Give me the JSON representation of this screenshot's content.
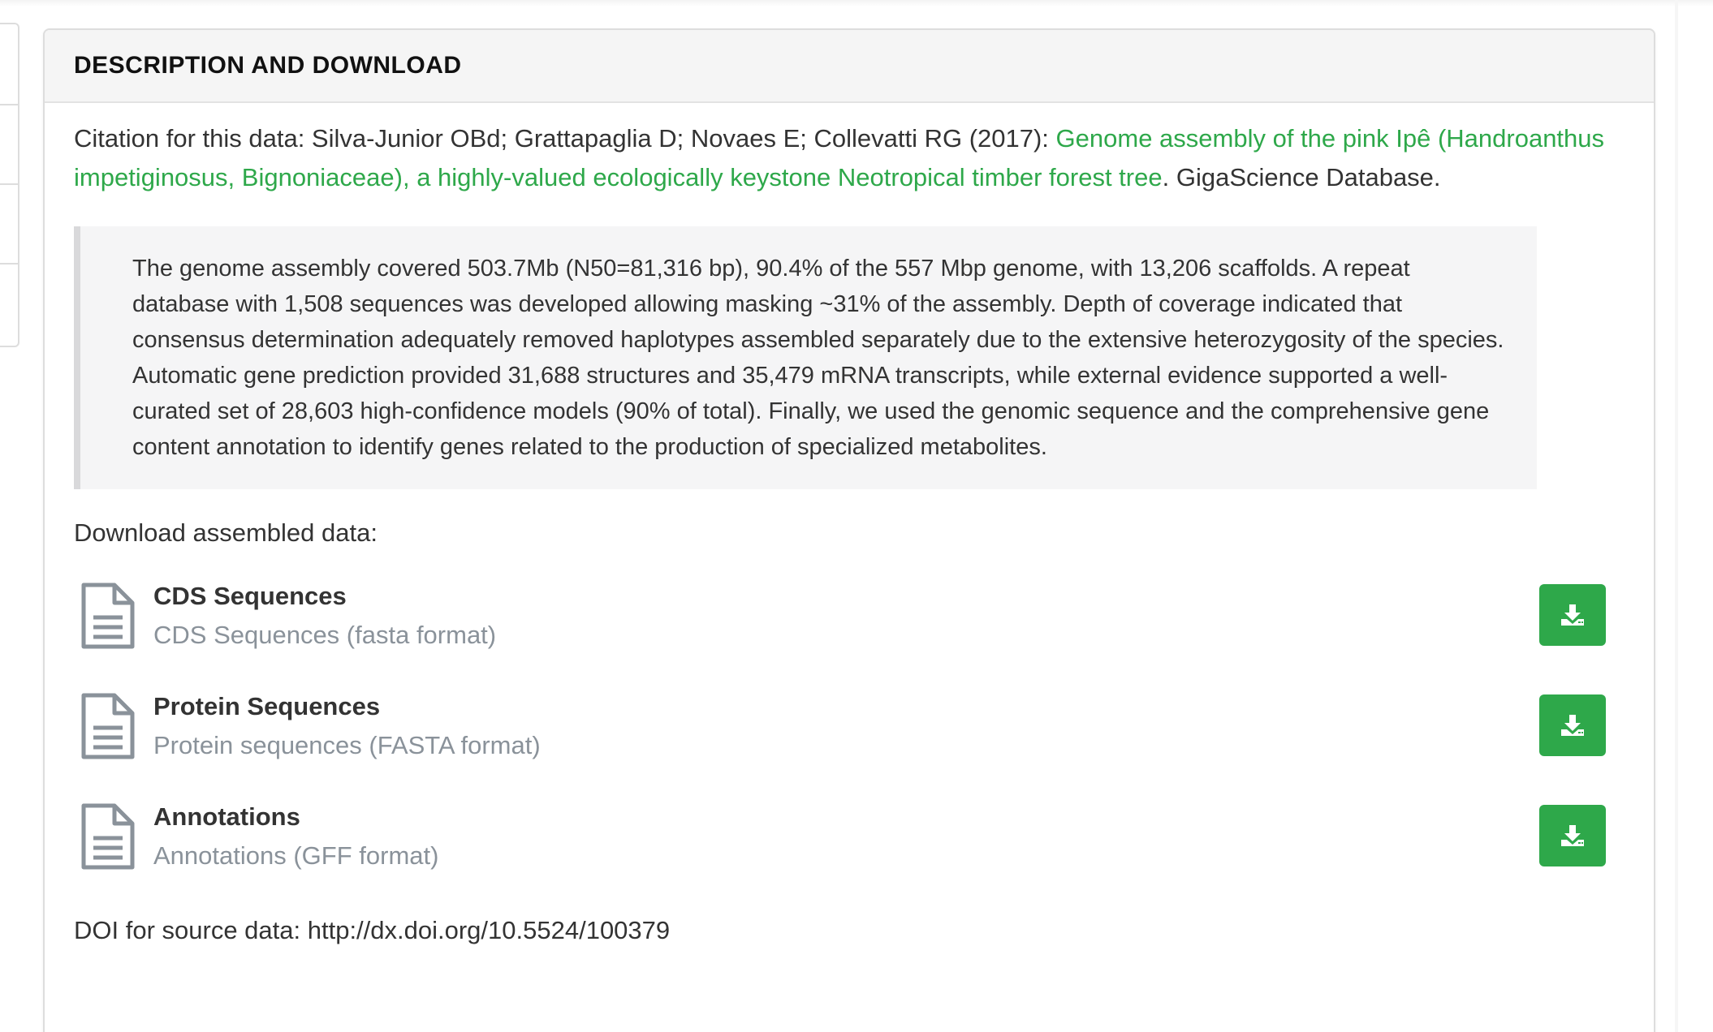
{
  "panel": {
    "title": "DESCRIPTION AND DOWNLOAD"
  },
  "citation": {
    "prefix": "Citation for this data: Silva-Junior OBd; Grattapaglia D; Novaes E; Collevatti RG (2017): ",
    "link_text": "Genome assembly of the pink Ipê (Handroanthus impetiginosus, Bignoniaceae), a highly-valued ecologically keystone Neotropical timber forest tree",
    "suffix": ". GigaScience Database."
  },
  "abstract": {
    "text": "The genome assembly covered 503.7Mb (N50=81,316 bp), 90.4% of the 557 Mbp genome, with 13,206 scaffolds. A repeat database with 1,508 sequences was developed allowing masking ~31% of the assembly. Depth of coverage indicated that consensus determination adequately removed haplotypes assembled separately due to the extensive heterozygosity of the species. Automatic gene prediction provided 31,688 structures and 35,479 mRNA transcripts, while external evidence supported a well-curated set of 28,603 high-confidence models (90% of total). Finally, we used the genomic sequence and the comprehensive gene content annotation to identify genes related to the production of specialized metabolites."
  },
  "downloads": {
    "label": "Download assembled data:",
    "files": [
      {
        "name": "CDS Sequences",
        "description": "CDS Sequences (fasta format)",
        "icon": "file-text-icon",
        "button_icon": "download-icon"
      },
      {
        "name": "Protein Sequences",
        "description": "Protein sequences (FASTA format)",
        "icon": "file-text-icon",
        "button_icon": "download-icon"
      },
      {
        "name": "Annotations",
        "description": "Annotations (GFF format)",
        "icon": "file-text-icon",
        "button_icon": "download-icon"
      }
    ]
  },
  "doi": {
    "text": "DOI for source data: http://dx.doi.org/10.5524/100379"
  },
  "colors": {
    "accent_green": "#2ea84a",
    "muted_text": "#8a929a",
    "heading_bg": "#f5f5f5",
    "quote_bg": "#f5f5f6"
  }
}
